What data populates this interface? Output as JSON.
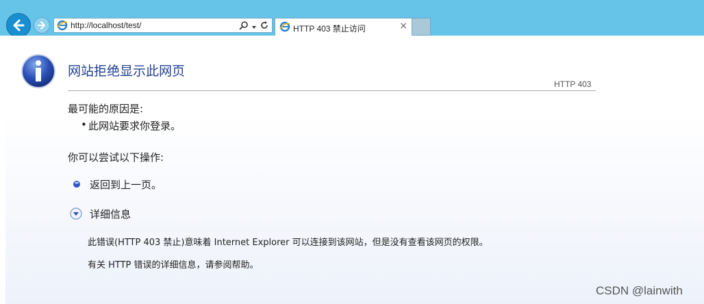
{
  "browser": {
    "address_url": "http://localhost/test/",
    "tab_title": "HTTP 403 禁止访问",
    "tab_close": "×",
    "accent_color": "#66c4e8"
  },
  "page": {
    "title": "网站拒绝显示此网页",
    "code": "HTTP 403",
    "cause_heading": "最可能的原因是:",
    "causes": [
      "此网站要求你登录。"
    ],
    "try_heading": "你可以尝试以下操作:",
    "back_link": "返回到上一页。",
    "more_info": "详细信息",
    "detail_1": "此错误(HTTP 403 禁止)意味着 Internet Explorer 可以连接到该网站，但是没有查看该网页的权限。",
    "detail_2": "有关 HTTP 错误的详细信息，请参阅帮助。"
  },
  "watermark": "CSDN @lainwith"
}
